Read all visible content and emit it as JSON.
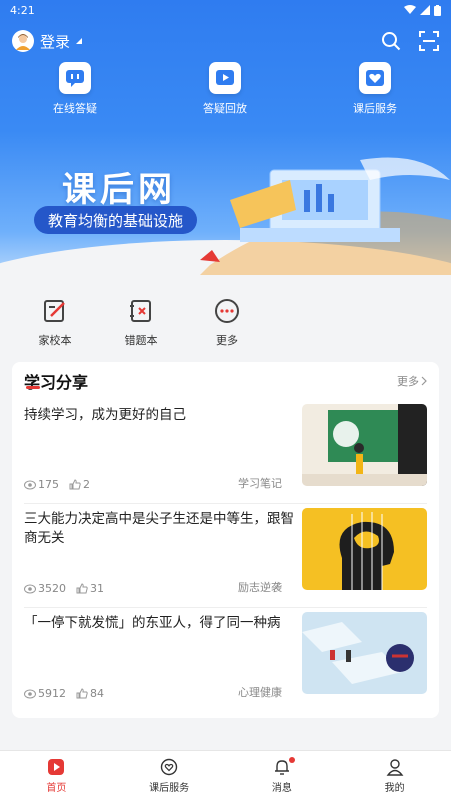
{
  "status_bar": {
    "time": "4:21"
  },
  "header": {
    "login_label": "登录"
  },
  "quick_actions": [
    {
      "label": "在线答疑",
      "icon": "chat-icon"
    },
    {
      "label": "答疑回放",
      "icon": "play-icon"
    },
    {
      "label": "课后服务",
      "icon": "heart-icon"
    }
  ],
  "banner": {
    "title": "课后网",
    "slogan": "教育均衡的基础设施"
  },
  "tools": [
    {
      "label": "家校本",
      "icon": "edit-icon"
    },
    {
      "label": "错题本",
      "icon": "wrong-book-icon"
    },
    {
      "label": "更多",
      "icon": "more-icon"
    }
  ],
  "section": {
    "title": "学习分享",
    "more_label": "更多"
  },
  "articles": [
    {
      "title": "持续学习，成为更好的自己",
      "views": "175",
      "likes": "2",
      "tag": "学习笔记"
    },
    {
      "title": "三大能力决定高中是尖子生还是中等生，跟智商无关",
      "views": "3520",
      "likes": "31",
      "tag": "励志逆袭"
    },
    {
      "title": "「一停下就发慌」的东亚人，得了同一种病",
      "views": "5912",
      "likes": "84",
      "tag": "心理健康"
    }
  ],
  "bottom_nav": [
    {
      "label": "首页",
      "icon": "home-icon",
      "active": true
    },
    {
      "label": "课后服务",
      "icon": "service-icon",
      "active": false
    },
    {
      "label": "消息",
      "icon": "bell-icon",
      "active": false
    },
    {
      "label": "我的",
      "icon": "user-icon",
      "active": false
    }
  ],
  "colors": {
    "primary": "#2f7cf0",
    "accent": "#e53935"
  }
}
